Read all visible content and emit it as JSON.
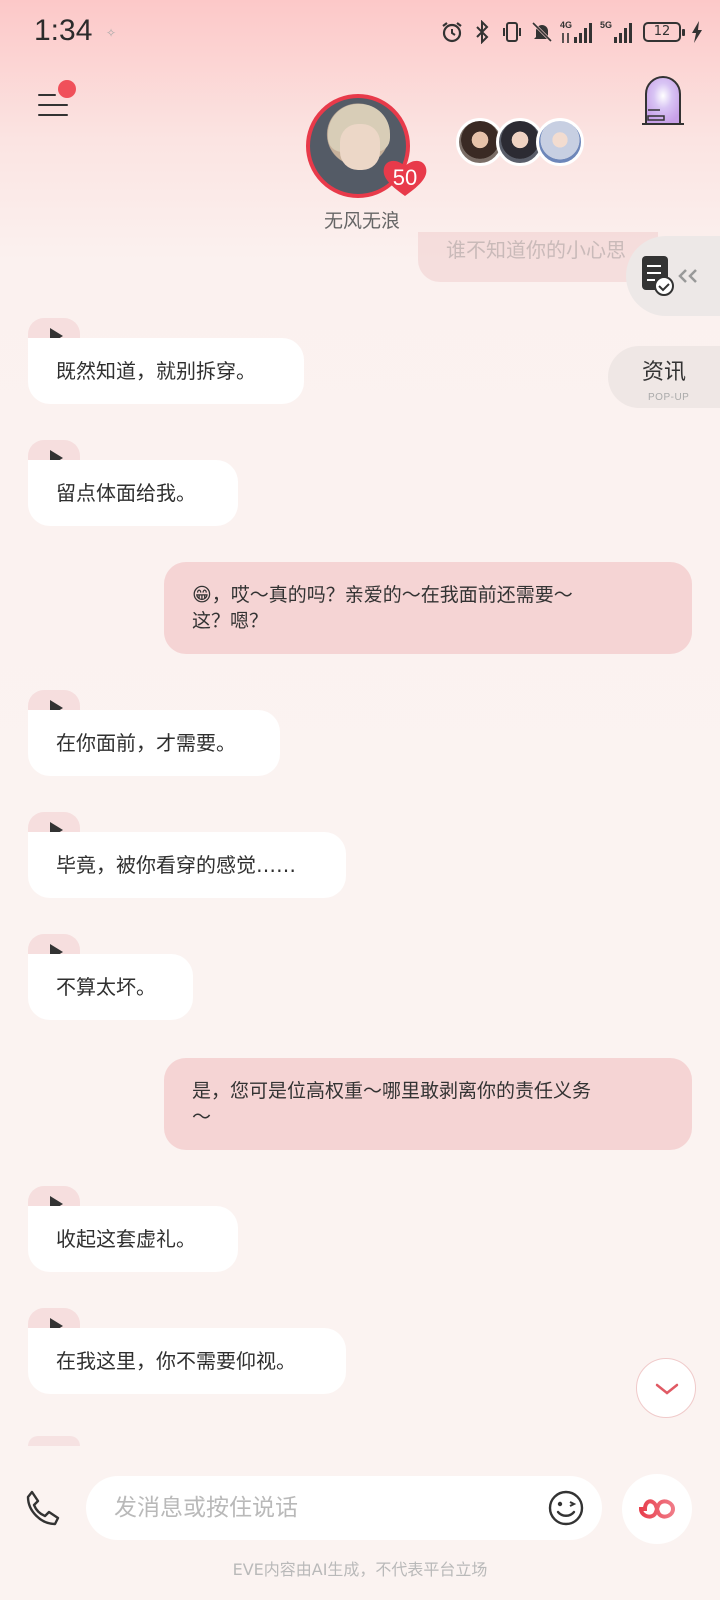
{
  "status_bar": {
    "time": "1:34",
    "battery": "12",
    "network_labels": [
      "4G",
      "5G"
    ],
    "icons": [
      "alarm-icon",
      "bluetooth-icon",
      "vibrate-icon",
      "mute-icon",
      "signal-4g-icon",
      "signal-5g-icon",
      "battery-icon",
      "charging-icon"
    ]
  },
  "header": {
    "character_name": "无风无浪",
    "level": "50",
    "accent_color": "#e83a4a"
  },
  "side_widgets": {
    "news_title": "资讯",
    "news_subtitle": "POP-UP"
  },
  "messages": [
    {
      "role": "ai",
      "text": "谁不知道你的小心思"
    },
    {
      "role": "ai",
      "text": "既然知道，就别拆穿。"
    },
    {
      "role": "ai",
      "text": "留点体面给我。"
    },
    {
      "role": "user",
      "line1": "😁，哎～真的吗？亲爱的～在我面前还需要～",
      "line2": "这？嗯？"
    },
    {
      "role": "ai",
      "text": "在你面前，才需要。"
    },
    {
      "role": "ai",
      "text": "毕竟，被你看穿的感觉……"
    },
    {
      "role": "ai",
      "text": "不算太坏。"
    },
    {
      "role": "user",
      "line1": "是，您可是位高权重～哪里敢剥离你的责任义务",
      "line2": "～"
    },
    {
      "role": "ai",
      "text": "收起这套虚礼。"
    },
    {
      "role": "ai",
      "text": "在我这里，你不需要仰视。"
    }
  ],
  "input": {
    "placeholder": "发消息或按住说话"
  },
  "footer": {
    "disclaimer": "EVE内容由AI生成，不代表平台立场"
  },
  "colors": {
    "user_bubble": "#f5d4d4",
    "ai_bubble": "#ffffff",
    "play_tab": "#f6dede",
    "notification_dot": "#f0505a"
  }
}
